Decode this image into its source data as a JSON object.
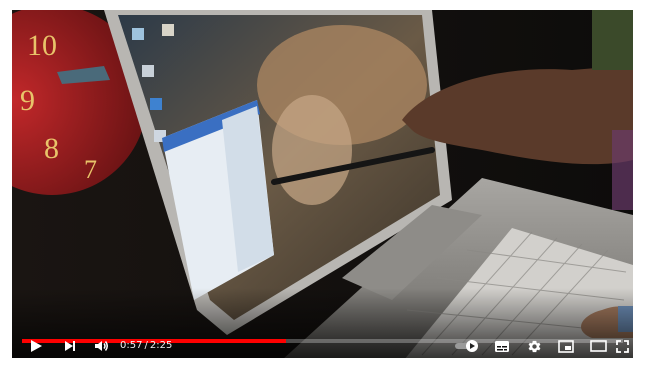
{
  "player": {
    "progress": {
      "played_fraction": 0.44,
      "loaded_fraction": 0.44
    },
    "time": {
      "current": "0:57",
      "separator": "/",
      "duration": "2:25"
    }
  },
  "colors": {
    "progress_played": "#ff0000",
    "controls": "#ffffff"
  },
  "icons": {
    "play": "play-icon",
    "next": "next-icon",
    "volume": "volume-icon",
    "autoplay": "autoplay-toggle-icon",
    "subtitles": "subtitles-icon",
    "settings": "gear-icon",
    "miniplayer": "miniplayer-icon",
    "theater": "theater-mode-icon",
    "fullscreen": "fullscreen-icon"
  }
}
